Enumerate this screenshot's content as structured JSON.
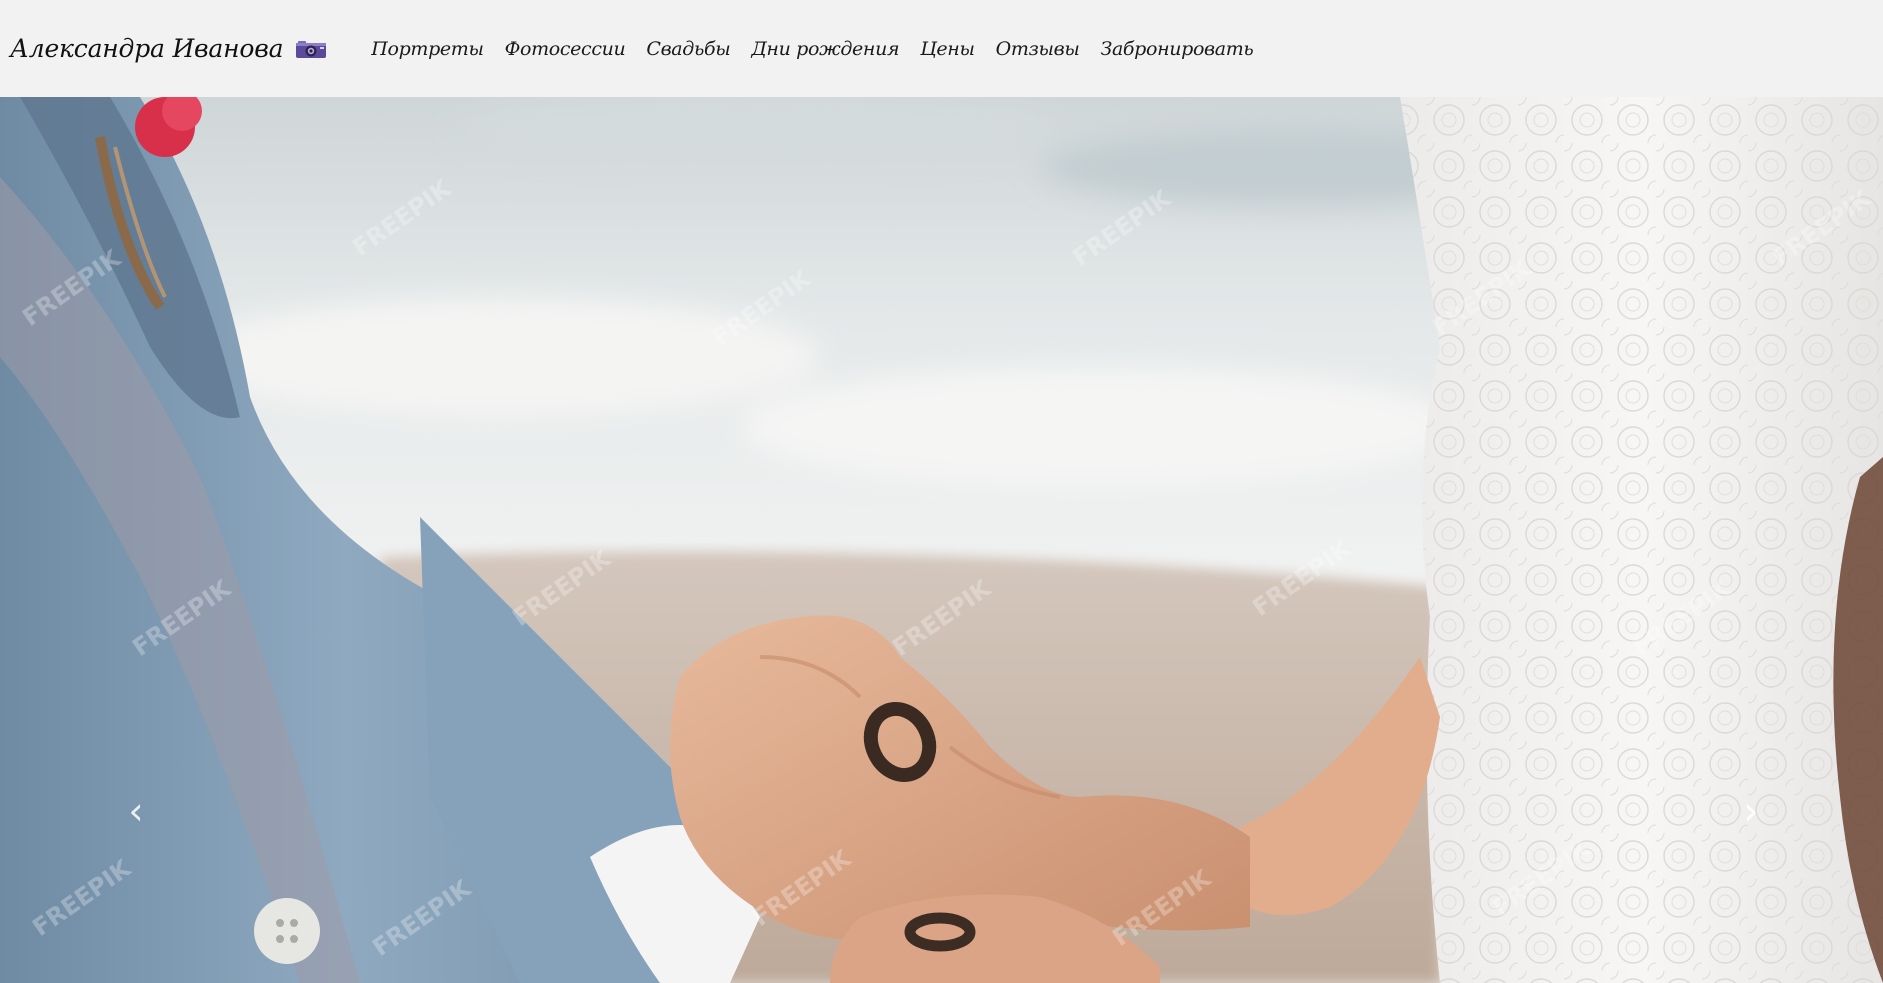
{
  "header": {
    "brand_name": "Александра Иванова",
    "brand_icon": "camera-icon",
    "nav": [
      {
        "label": "Портреты"
      },
      {
        "label": "Фотосессии"
      },
      {
        "label": "Свадьбы"
      },
      {
        "label": "Дни рождения"
      },
      {
        "label": "Цены"
      },
      {
        "label": "Отзывы"
      },
      {
        "label": "Забронировать"
      }
    ]
  },
  "carousel": {
    "image_alt": "",
    "prev_glyph": "‹",
    "next_glyph": "›",
    "watermark": "FREEPIK"
  },
  "colors": {
    "header_bg": "#f2f2f2",
    "text": "#111111",
    "camera_body": "#5b4a9a",
    "suit": "#7f9cb5",
    "sea": "#dfe3e4",
    "sand": "#c9b6a6",
    "lace": "#f3f1ef"
  }
}
